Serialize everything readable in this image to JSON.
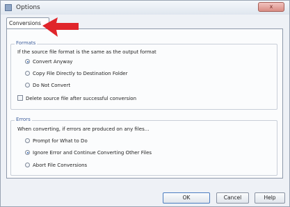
{
  "window": {
    "title": "Options",
    "close_label": "x"
  },
  "tabs": [
    {
      "label": "Conversions"
    }
  ],
  "formats": {
    "legend": "Formats",
    "prompt": "If the source file format is the same as the output format",
    "options": [
      {
        "label": "Convert Anyway",
        "selected": true
      },
      {
        "label": "Copy File Directly to Destination Folder",
        "selected": false
      },
      {
        "label": "Do Not Convert",
        "selected": false
      }
    ],
    "delete_source_label": "Delete source file after successful conversion",
    "delete_source_checked": false
  },
  "errors": {
    "legend": "Errors",
    "prompt": "When converting, if errors are produced on any files...",
    "options": [
      {
        "label": "Prompt for What to Do",
        "selected": false
      },
      {
        "label": "Ignore Error and Continue Converting Other Files",
        "selected": true
      },
      {
        "label": "Abort File Conversions",
        "selected": false
      }
    ]
  },
  "buttons": {
    "ok": "OK",
    "cancel": "Cancel",
    "help": "Help"
  },
  "colors": {
    "arrow": "#e0252b",
    "accent": "#2a5fb0",
    "legend": "#3f5f9c"
  }
}
